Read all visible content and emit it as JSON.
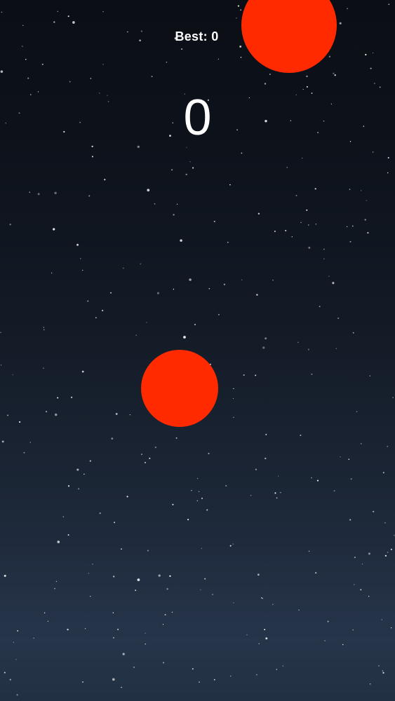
{
  "hud": {
    "best_label": "Best: 0",
    "score": "0"
  },
  "colors": {
    "ball": "#ff2a00",
    "text": "#ffffff",
    "sky_top": "#0b0e15",
    "sky_bottom": "#2b3a50"
  },
  "objects": {
    "falling_ball": "falling-ball",
    "player_ball": "player-ball"
  }
}
